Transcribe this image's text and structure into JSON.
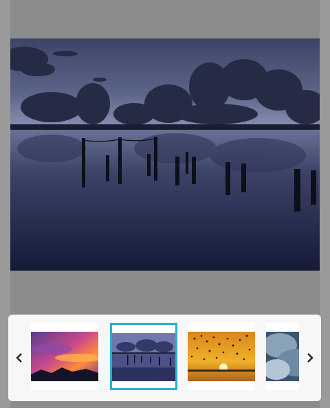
{
  "gallery": {
    "main_image": {
      "alt_icon": "lake-at-dusk-with-posts-image",
      "sky_color": "#3b4263",
      "water_color": "#1d2446"
    },
    "nav": {
      "prev_icon": "chevron-left-icon",
      "next_icon": "chevron-right-icon"
    },
    "thumbnails": [
      {
        "icon": "sunset-clouds-pink-image",
        "selected": false
      },
      {
        "icon": "lake-at-dusk-with-posts-image",
        "selected": true
      },
      {
        "icon": "birds-over-golden-sunset-image",
        "selected": false
      },
      {
        "icon": "storm-clouds-blue-image",
        "selected": false
      }
    ],
    "accent_color": "#27b0ce"
  }
}
